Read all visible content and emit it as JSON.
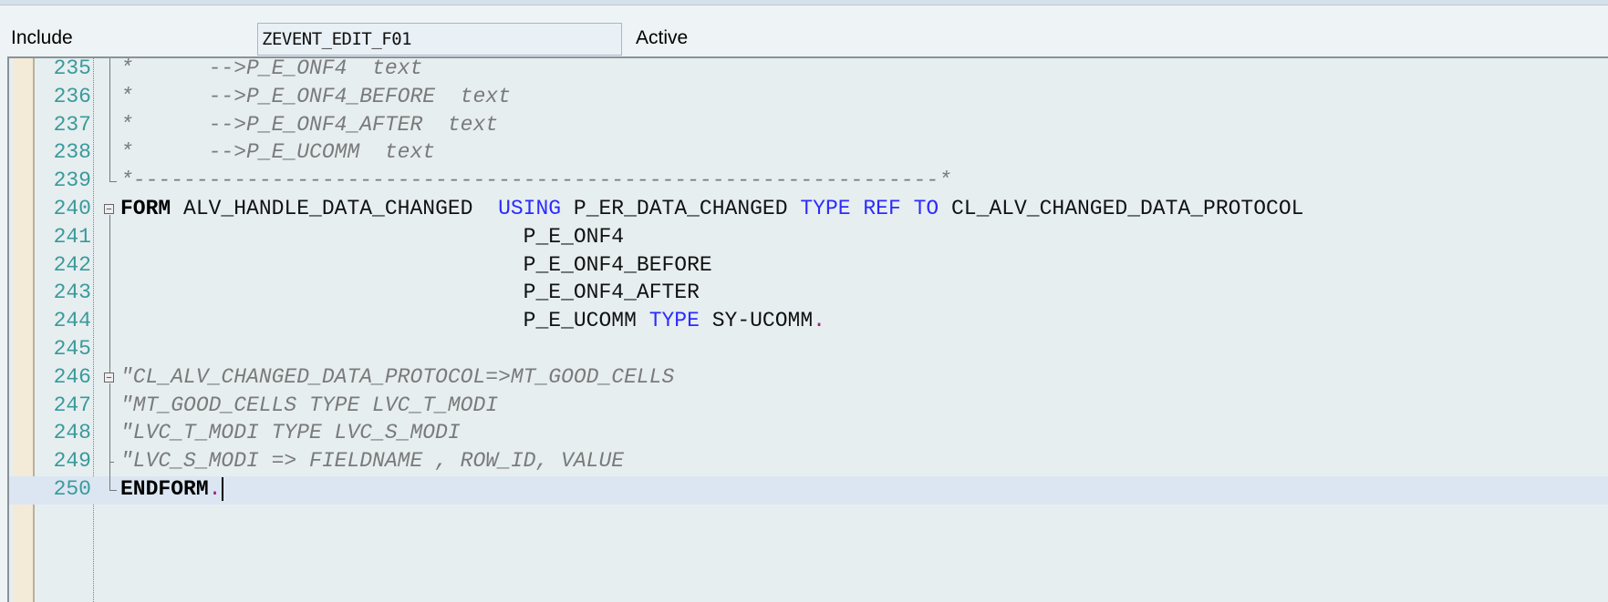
{
  "header": {
    "include_label": "Include",
    "include_value": "ZEVENT_EDIT_F01",
    "status": "Active"
  },
  "editor": {
    "lines": [
      {
        "num": "235",
        "tokens": [
          {
            "t": "comment",
            "v": "*      -->P_E_ONF4  text"
          }
        ]
      },
      {
        "num": "236",
        "tokens": [
          {
            "t": "comment",
            "v": "*      -->P_E_ONF4_BEFORE  text"
          }
        ]
      },
      {
        "num": "237",
        "tokens": [
          {
            "t": "comment",
            "v": "*      -->P_E_ONF4_AFTER  text"
          }
        ]
      },
      {
        "num": "238",
        "tokens": [
          {
            "t": "comment",
            "v": "*      -->P_E_UCOMM  text"
          }
        ]
      },
      {
        "num": "239",
        "tokens": [
          {
            "t": "comment",
            "v": "*----------------------------------------------------------------*"
          }
        ]
      },
      {
        "num": "240",
        "tokens": [
          {
            "t": "kw",
            "v": "FORM"
          },
          {
            "t": "plain",
            "v": " ALV_HANDLE_DATA_CHANGED  "
          },
          {
            "t": "blue",
            "v": "USING"
          },
          {
            "t": "plain",
            "v": " P_ER_DATA_CHANGED "
          },
          {
            "t": "blue",
            "v": "TYPE REF TO"
          },
          {
            "t": "plain",
            "v": " CL_ALV_CHANGED_DATA_PROTOCOL"
          }
        ]
      },
      {
        "num": "241",
        "tokens": [
          {
            "t": "plain",
            "v": "                                P_E_ONF4"
          }
        ]
      },
      {
        "num": "242",
        "tokens": [
          {
            "t": "plain",
            "v": "                                P_E_ONF4_BEFORE"
          }
        ]
      },
      {
        "num": "243",
        "tokens": [
          {
            "t": "plain",
            "v": "                                P_E_ONF4_AFTER"
          }
        ]
      },
      {
        "num": "244",
        "tokens": [
          {
            "t": "plain",
            "v": "                                P_E_UCOMM "
          },
          {
            "t": "blue",
            "v": "TYPE"
          },
          {
            "t": "plain",
            "v": " SY-UCOMM"
          },
          {
            "t": "punct",
            "v": "."
          }
        ]
      },
      {
        "num": "245",
        "tokens": []
      },
      {
        "num": "246",
        "tokens": [
          {
            "t": "comment",
            "v": "\"CL_ALV_CHANGED_DATA_PROTOCOL=>MT_GOOD_CELLS"
          }
        ]
      },
      {
        "num": "247",
        "tokens": [
          {
            "t": "comment",
            "v": "\"MT_GOOD_CELLS TYPE LVC_T_MODI"
          }
        ]
      },
      {
        "num": "248",
        "tokens": [
          {
            "t": "comment",
            "v": "\"LVC_T_MODI TYPE LVC_S_MODI"
          }
        ]
      },
      {
        "num": "249",
        "tokens": [
          {
            "t": "comment",
            "v": "\"LVC_S_MODI => FIELDNAME , ROW_ID, VALUE"
          }
        ]
      },
      {
        "num": "250",
        "tokens": [
          {
            "t": "kw",
            "v": "ENDFORM"
          },
          {
            "t": "punct",
            "v": "."
          }
        ],
        "current": true
      }
    ]
  }
}
